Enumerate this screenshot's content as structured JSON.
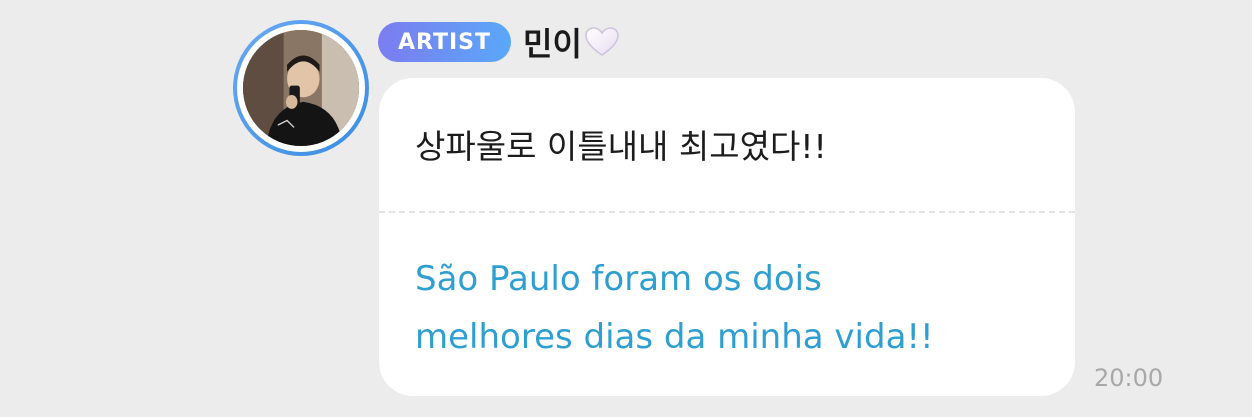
{
  "message": {
    "badge_label": "ARTIST",
    "author_name": "민이",
    "name_emoji": "white-heart-icon",
    "text": "상파울로 이틀내내 최고였다!!",
    "translation_line1": "São Paulo foram os dois",
    "translation_line2": "melhores dias da minha vida!!",
    "timestamp": "20:00"
  },
  "colors": {
    "background": "#ececec",
    "bubble": "#ffffff",
    "translation_text": "#2f9fd1",
    "badge_gradient_start": "#7c7cf0",
    "badge_gradient_end": "#5aa8f8",
    "avatar_ring": "#3a8de0",
    "timestamp": "#a8a8a8"
  }
}
